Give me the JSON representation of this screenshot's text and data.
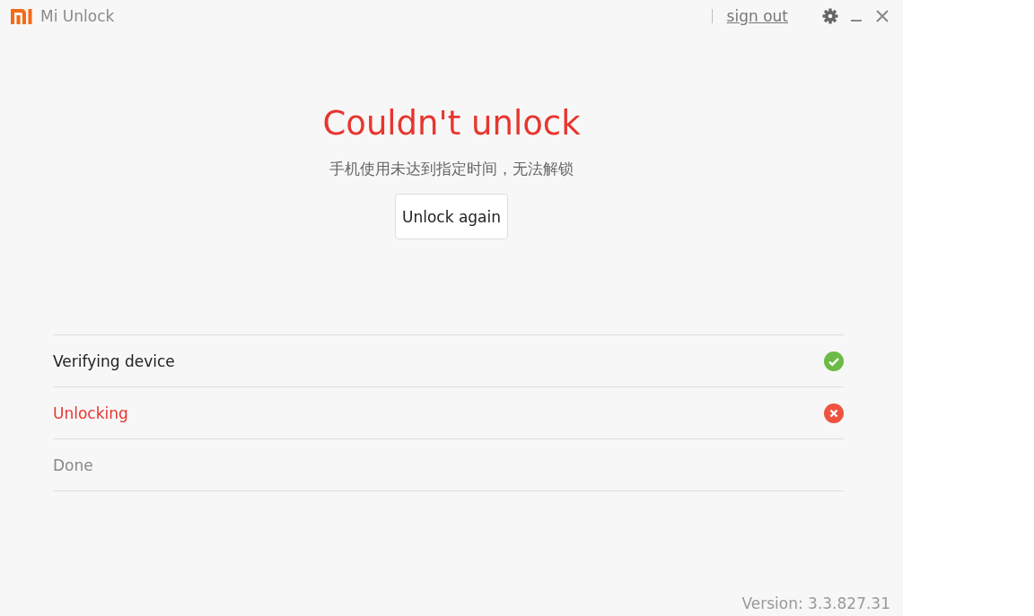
{
  "window": {
    "title": "Mi Unlock",
    "sign_out": "sign out"
  },
  "result": {
    "title": "Couldn't unlock",
    "message": "手机使用未达到指定时间，无法解锁",
    "button": "Unlock again"
  },
  "steps": [
    {
      "label": "Verifying device",
      "kind": "done"
    },
    {
      "label": "Unlocking",
      "kind": "failed"
    },
    {
      "label": "Done",
      "kind": "pending"
    }
  ],
  "version": "Version: 3.3.827.31"
}
